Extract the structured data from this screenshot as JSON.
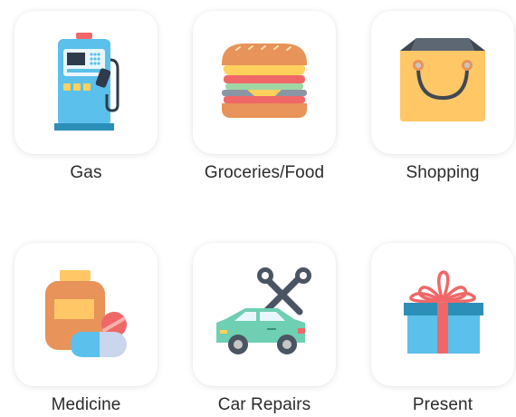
{
  "categories": [
    {
      "label": "Gas",
      "icon": "gas-pump-icon"
    },
    {
      "label": "Groceries/Food",
      "icon": "sandwich-icon"
    },
    {
      "label": "Shopping",
      "icon": "shopping-bag-icon"
    },
    {
      "label": "Medicine",
      "icon": "medicine-bottle-icon"
    },
    {
      "label": "Car Repairs",
      "icon": "car-repair-icon"
    },
    {
      "label": "Present",
      "icon": "gift-icon"
    }
  ],
  "colors": {
    "card_background": "#ffffff",
    "label_text": "#2b2b2b"
  }
}
